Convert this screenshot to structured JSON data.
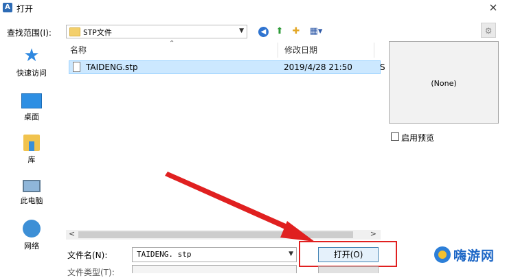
{
  "window": {
    "title": "打开",
    "app_icon": "A",
    "close_symbol": "×"
  },
  "toolbar": {
    "lookin_label": "查找范围(I):",
    "lookin_value": "STP文件",
    "icons": [
      "back-icon",
      "up-folder-icon",
      "new-folder-icon",
      "views-menu-icon",
      "tools-icon"
    ]
  },
  "places": [
    {
      "label": "快速访问",
      "icon": "quick-access-star-icon"
    },
    {
      "label": "桌面",
      "icon": "desktop-icon"
    },
    {
      "label": "库",
      "icon": "library-icon"
    },
    {
      "label": "此电脑",
      "icon": "computer-icon"
    },
    {
      "label": "网络",
      "icon": "network-icon"
    }
  ],
  "file_list": {
    "columns": [
      "名称",
      "修改日期"
    ],
    "rows": [
      {
        "name": "TAIDENG.stp",
        "date": "2019/4/28 21:50",
        "extra": "S",
        "selected": true
      }
    ]
  },
  "preview": {
    "text": "(None)",
    "checkbox_label": "启用预览",
    "checked": false
  },
  "footer": {
    "filename_label": "文件名(N):",
    "filename_value": "TAIDENG. stp",
    "open_button": "打开(O)",
    "filetype_label": "文件类型(T):"
  },
  "annotation": {
    "highlight_color": "#e02020",
    "arrow_color": "#e02020"
  },
  "watermark": {
    "text": "嗨游网"
  }
}
